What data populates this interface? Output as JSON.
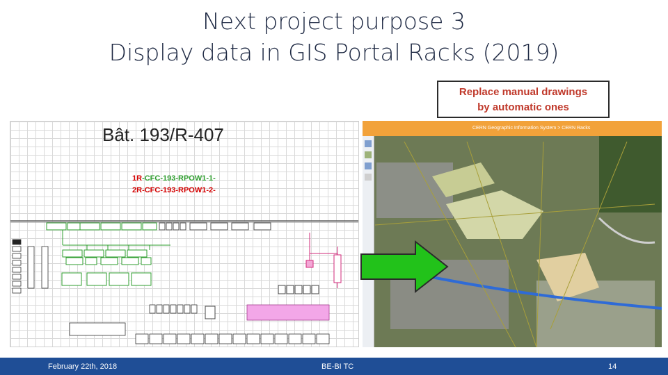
{
  "slide": {
    "title_line1": "Next project purpose 3",
    "title_line2": "Display data in GIS Portal Racks (2019)",
    "callout": {
      "line1": "Replace manual drawings",
      "line2": "by automatic ones"
    }
  },
  "drawing": {
    "heading": "Bât. 193/R-407",
    "rack_lines": [
      {
        "prefix": "1R",
        "suffix": "-CFC-193-RPOW1-1-",
        "prefix_color": "#d40000",
        "suffix_color": "#2e9d2e"
      },
      {
        "prefix": "2R",
        "suffix": "-CFC-193-RPOW1-2-",
        "prefix_color": "#d40000",
        "suffix_color": "#d40000"
      }
    ]
  },
  "map": {
    "header": "CERN Geographic Information System > CERN Racks",
    "arrow_color": "#22c21a"
  },
  "footer": {
    "date": "February 22th, 2018",
    "group": "BE-BI TC",
    "page": "14"
  },
  "colors": {
    "footer_bg": "#1f4e96",
    "callout_text": "#c0392b",
    "map_header": "#f2a23a"
  }
}
